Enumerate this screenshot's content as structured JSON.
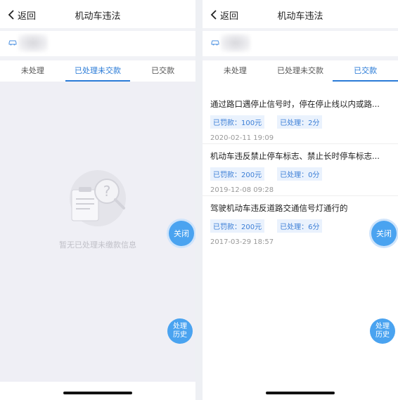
{
  "nav": {
    "back_label": "返回",
    "title": "机动车违法"
  },
  "tabs": [
    "未处理",
    "已处理未交款",
    "已交款"
  ],
  "left": {
    "active_tab": "已处理未交款",
    "empty_text": "暂无已处理未缴款信息"
  },
  "right": {
    "active_tab": "已交款",
    "violations": [
      {
        "title": "通过路口遇停止信号时，停在停止线以内或路...",
        "fine": "已罚款：100元",
        "points": "已处理：2分",
        "date": "2020-02-11 19:09"
      },
      {
        "title": "机动车违反禁止停车标志、禁止长时停车标志...",
        "fine": "已罚款：200元",
        "points": "已处理：0分",
        "date": "2019-12-08 09:28"
      },
      {
        "title": "驾驶机动车违反道路交通信号灯通行的",
        "fine": "已罚款：200元",
        "points": "已处理：6分",
        "date": "2017-03-29 18:57"
      }
    ]
  },
  "fab": {
    "close_label": "关闭",
    "history_label": "处理历史",
    "history_line1": "处理",
    "history_line2": "历史"
  },
  "colors": {
    "accent": "#2a7bd7",
    "fab": "#4aa3f0",
    "badge_bg": "#eaf2fd"
  },
  "icons": [
    "chevron-left-icon",
    "car-icon",
    "clipboard-question-icon"
  ]
}
